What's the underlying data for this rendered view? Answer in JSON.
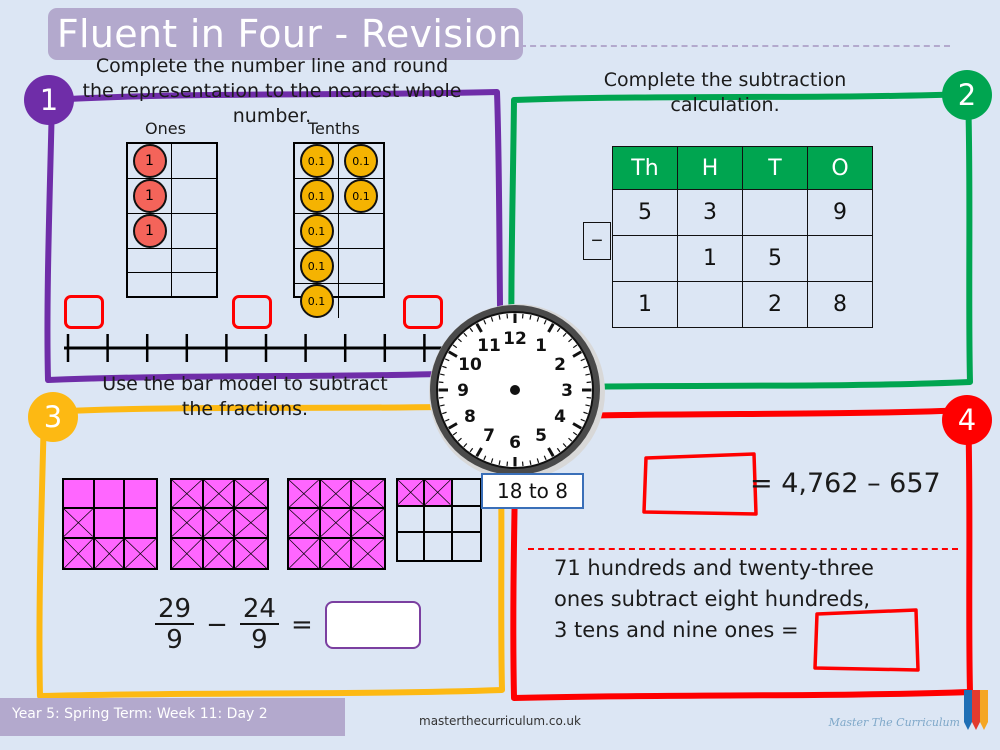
{
  "header": {
    "title": "Fluent in Four - Revision"
  },
  "sections": [
    {
      "badge": "1",
      "color": "#6f2da8",
      "instruction": "Complete the number line and round the representation to the nearest whole number.",
      "place_value": {
        "ones_label": "Ones",
        "tenths_label": "Tenths",
        "ones_counter_label": "1",
        "tenths_counter_label": "0.1",
        "ones_count": 3,
        "tenths_count": 7,
        "frame_rows": 5,
        "frame_cols": 2
      },
      "number_line": {
        "ticks": 11,
        "answer_box_ticks": [
          0,
          5,
          10
        ]
      }
    },
    {
      "badge": "2",
      "color": "#00a550",
      "instruction": "Complete the subtraction calculation.",
      "table": {
        "headers": [
          "Th",
          "H",
          "T",
          "O"
        ],
        "operator": "−",
        "rows": [
          [
            "5",
            "3",
            "",
            "9"
          ],
          [
            "",
            "1",
            "5",
            ""
          ],
          [
            "1",
            "",
            "2",
            "8"
          ]
        ]
      }
    },
    {
      "badge": "3",
      "color": "#fdb913",
      "instruction": "Use the bar model to subtract the fractions.",
      "bar_models": [
        {
          "name": "bar-model-1",
          "cells": [
            "fill",
            "fill",
            "fill",
            "cross",
            "fill",
            "fill",
            "cross",
            "cross",
            "cross"
          ]
        },
        {
          "name": "bar-model-2",
          "cells": [
            "cross",
            "cross",
            "cross",
            "cross",
            "cross",
            "cross",
            "cross",
            "cross",
            "cross"
          ]
        },
        {
          "name": "bar-model-3",
          "cells": [
            "cross",
            "cross",
            "cross",
            "cross",
            "cross",
            "cross",
            "cross",
            "cross",
            "cross"
          ]
        },
        {
          "name": "bar-model-4",
          "cells": [
            "cross",
            "cross",
            "empty",
            "empty",
            "empty",
            "empty",
            "empty",
            "empty",
            "empty"
          ]
        }
      ],
      "equation": {
        "first_numerator": "29",
        "first_denominator": "9",
        "operator": "−",
        "second_numerator": "24",
        "second_denominator": "9",
        "equals": "=",
        "answer": ""
      }
    },
    {
      "badge": "4",
      "color": "#ff0000",
      "equation_top": "= 4,762 – 657",
      "answer_top": "",
      "word_problem_lines": [
        "71 hundreds and twenty-three",
        "ones subtract eight hundreds,",
        "3 tens and nine ones ="
      ],
      "answer_bottom": ""
    }
  ],
  "clock": {
    "numerals": [
      "12",
      "1",
      "2",
      "3",
      "4",
      "5",
      "6",
      "7",
      "8",
      "9",
      "10",
      "11"
    ],
    "label": "18 to 8",
    "hour_hand": "",
    "minute_hand": ""
  },
  "footer": {
    "term_info": "Year 5: Spring Term: Week 11: Day 2",
    "website": "masterthecurriculum.co.uk",
    "brand": "Master The Curriculum"
  }
}
